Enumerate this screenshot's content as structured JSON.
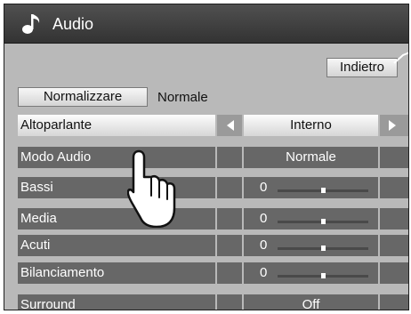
{
  "header": {
    "title": "Audio",
    "icon": "music-note-icon"
  },
  "back_label": "Indietro",
  "normalize": {
    "button_label": "Normalizzare",
    "status": "Normale"
  },
  "rows": [
    {
      "label": "Altoparlante",
      "value": "Interno"
    },
    {
      "label": "Modo Audio",
      "value": "Normale"
    },
    {
      "label": "Bassi",
      "value": "0",
      "slider_fraction": 0.5
    },
    {
      "label": "Media",
      "value": "0",
      "slider_fraction": 0.5
    },
    {
      "label": "Acuti",
      "value": "0",
      "slider_fraction": 0.5
    },
    {
      "label": "Bilanciamento",
      "value": "0",
      "slider_fraction": 0.5
    },
    {
      "label": "Surround",
      "value": "Off"
    }
  ],
  "colors": {
    "panel": "#b9b9b9",
    "row": "#676767",
    "selected_row": "#f0f0f0",
    "titlebar": "#3a3a3a"
  },
  "pointer_icon": "hand-pointer-icon"
}
